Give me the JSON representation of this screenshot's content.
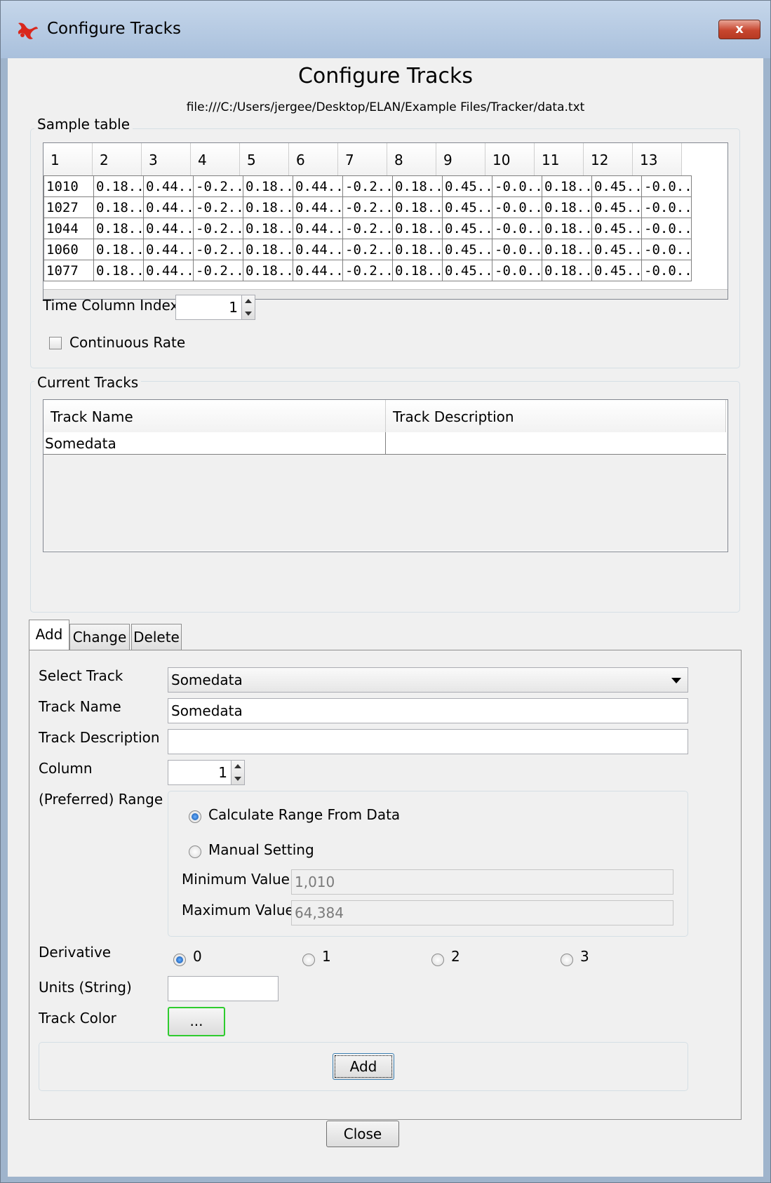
{
  "window": {
    "title": "Configure Tracks",
    "close_label": "x"
  },
  "dialog": {
    "heading": "Configure Tracks",
    "file_path": "file:///C:/Users/jergee/Desktop/ELAN/Example Files/Tracker/data.txt"
  },
  "sample_table": {
    "legend": "Sample table",
    "headers": [
      "1",
      "2",
      "3",
      "4",
      "5",
      "6",
      "7",
      "8",
      "9",
      "10",
      "11",
      "12",
      "13"
    ],
    "rows": [
      [
        "1010",
        "0.18...",
        "0.44...",
        "-0.2...",
        "0.18...",
        "0.44...",
        "-0.2...",
        "0.18...",
        "0.45...",
        "-0.0...",
        "0.18...",
        "0.45...",
        "-0.0..."
      ],
      [
        "1027",
        "0.18...",
        "0.44...",
        "-0.2...",
        "0.18...",
        "0.44...",
        "-0.2...",
        "0.18...",
        "0.45...",
        "-0.0...",
        "0.18...",
        "0.45...",
        "-0.0..."
      ],
      [
        "1044",
        "0.18...",
        "0.44...",
        "-0.2...",
        "0.18...",
        "0.44...",
        "-0.2...",
        "0.18...",
        "0.45...",
        "-0.0...",
        "0.18...",
        "0.45...",
        "-0.0..."
      ],
      [
        "1060",
        "0.18...",
        "0.44...",
        "-0.2...",
        "0.18...",
        "0.44...",
        "-0.2...",
        "0.18...",
        "0.45...",
        "-0.0...",
        "0.18...",
        "0.45...",
        "-0.0..."
      ],
      [
        "1077",
        "0.18...",
        "0.44...",
        "-0.2...",
        "0.18...",
        "0.44...",
        "-0.2...",
        "0.18...",
        "0.45...",
        "-0.0...",
        "0.18...",
        "0.45...",
        "-0.0..."
      ]
    ],
    "time_column_label": "Time Column Index",
    "time_column_value": "1",
    "continuous_rate_label": "Continuous Rate"
  },
  "current_tracks": {
    "legend": "Current Tracks",
    "col_name": "Track Name",
    "col_desc": "Track Description",
    "rows": [
      {
        "name": "Somedata",
        "desc": ""
      }
    ]
  },
  "tabs": [
    "Add",
    "Change",
    "Delete"
  ],
  "form": {
    "select_track_label": "Select Track",
    "select_track_value": "Somedata",
    "track_name_label": "Track Name",
    "track_name_value": "Somedata",
    "track_desc_label": "Track Description",
    "track_desc_value": "",
    "column_label": "Column",
    "column_value": "1",
    "range_label": "(Preferred) Range",
    "calc_range_label": "Calculate Range From Data",
    "manual_label": "Manual Setting",
    "min_label": "Minimum Value",
    "min_value": "1,010",
    "max_label": "Maximum Value",
    "max_value": "64,384",
    "derivative_label": "Derivative",
    "derivative_options": [
      "0",
      "1",
      "2",
      "3"
    ],
    "derivative_selected": "0",
    "units_label": "Units (String)",
    "units_value": "",
    "color_label": "Track Color",
    "color_button": "...",
    "add_button": "Add"
  },
  "footer": {
    "close_button": "Close"
  },
  "colors": {
    "title_bar": "#b7cbe3",
    "close_red": "#c7462f",
    "focus_green": "#2ecc2e"
  }
}
